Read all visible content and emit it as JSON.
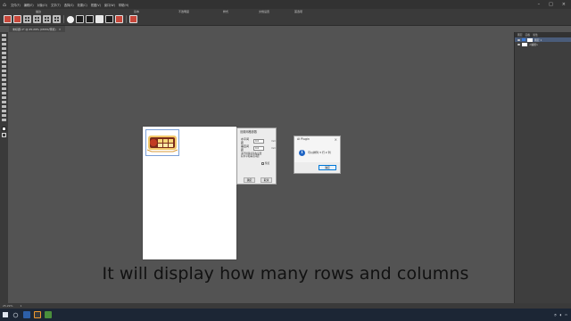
{
  "menubar": {
    "items": [
      "文件(F)",
      "编辑(E)",
      "对象(O)",
      "文字(T)",
      "选择(S)",
      "效果(C)",
      "视图(V)",
      "窗口(W)",
      "帮助(H)"
    ]
  },
  "optionbar": {
    "stroke_label": "描边",
    "basic_label": "基本",
    "opacity_label": "不透明度",
    "style_label": "样式",
    "doc_setup_label": "文档设置",
    "prefs_label": "首选项"
  },
  "doc_tab": {
    "title": "未标题-1* @ 25.29% (CMYK/预览)",
    "close": "×"
  },
  "layers_panel": {
    "tabs": [
      "图层",
      "画板",
      "属性"
    ],
    "layer_name": "图层 1",
    "sublayer_name": "<编组>"
  },
  "grid_dialog": {
    "title": "设置网格参数",
    "rows_label": "水平间距",
    "rows_value": "0.0",
    "cols_label": "垂直间距",
    "cols_value": "0.0",
    "unit": "mm",
    "description": "进行排版前请先设置好水平和垂直间距",
    "checkbox_label": "预览",
    "ok_label": "确定",
    "cancel_label": "取消"
  },
  "plugin_dialog": {
    "title": "AI Plugin",
    "close": "×",
    "message": "可以排列 3 行 2 列",
    "ok_label": "确定"
  },
  "status": {
    "zoom": "25.29%",
    "page": "1"
  },
  "caption": {
    "text": "It will display how many rows and columns"
  },
  "colors": {
    "workspace": "#535353",
    "panel": "#3e3e3e",
    "accent": "#1f64c4"
  }
}
